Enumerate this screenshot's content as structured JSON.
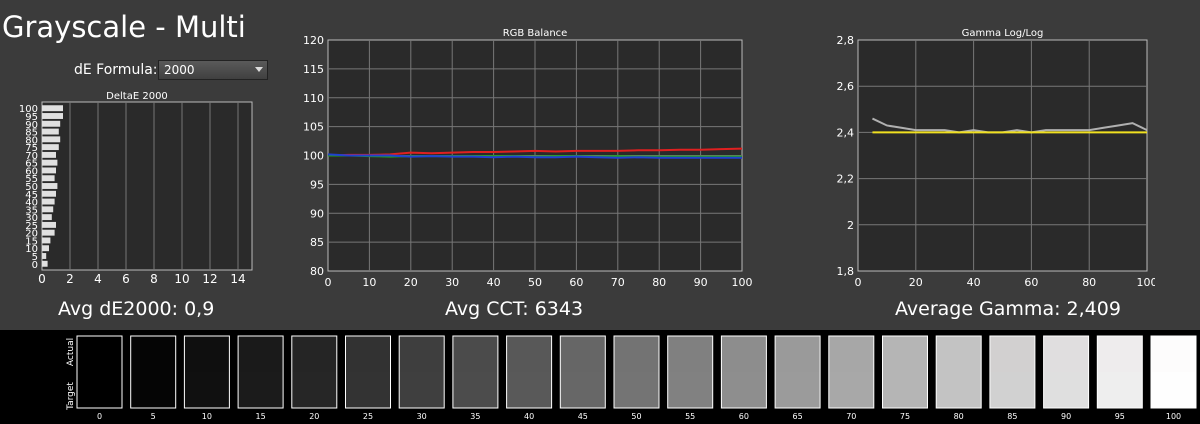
{
  "title": "Grayscale - Multi",
  "formula": {
    "label": "dE Formula:",
    "selected": "2000"
  },
  "averages": {
    "de": "Avg dE2000: 0,9",
    "cct": "Avg CCT: 6343",
    "gamma": "Average Gamma: 2,409"
  },
  "swatch_axis": {
    "actual": "Actual",
    "target": "Target"
  },
  "swatches": [
    {
      "level": "0",
      "actual": "#000000",
      "target": "#000000"
    },
    {
      "level": "5",
      "actual": "#050505",
      "target": "#050505"
    },
    {
      "level": "10",
      "actual": "#0f0f0f",
      "target": "#101010"
    },
    {
      "level": "15",
      "actual": "#1a1a1a",
      "target": "#1b1b1b"
    },
    {
      "level": "20",
      "actual": "#252525",
      "target": "#262626"
    },
    {
      "level": "25",
      "actual": "#323232",
      "target": "#333333"
    },
    {
      "level": "30",
      "actual": "#3e3e3e",
      "target": "#3f3f3f"
    },
    {
      "level": "35",
      "actual": "#4b4b4b",
      "target": "#4c4c4c"
    },
    {
      "level": "40",
      "actual": "#585858",
      "target": "#595959"
    },
    {
      "level": "45",
      "actual": "#666666",
      "target": "#676767"
    },
    {
      "level": "50",
      "actual": "#737373",
      "target": "#747474"
    },
    {
      "level": "55",
      "actual": "#808080",
      "target": "#818181"
    },
    {
      "level": "60",
      "actual": "#8d8d8d",
      "target": "#8e8e8e"
    },
    {
      "level": "65",
      "actual": "#9a9a9a",
      "target": "#9b9b9b"
    },
    {
      "level": "70",
      "actual": "#a7a7a7",
      "target": "#a8a8a8"
    },
    {
      "level": "75",
      "actual": "#b5b5b5",
      "target": "#b5b5b5"
    },
    {
      "level": "80",
      "actual": "#c3c3c3",
      "target": "#c3c3c3"
    },
    {
      "level": "85",
      "actual": "#d2d0d0",
      "target": "#d1d1d1"
    },
    {
      "level": "90",
      "actual": "#e0dedf",
      "target": "#dfdfdf"
    },
    {
      "level": "95",
      "actual": "#eeeced",
      "target": "#eeeeee"
    },
    {
      "level": "100",
      "actual": "#fdfcfc",
      "target": "#fefefe"
    }
  ],
  "chart_data": [
    {
      "type": "bar",
      "orientation": "horizontal",
      "title": "DeltaE 2000",
      "categories": [
        "0",
        "5",
        "10",
        "15",
        "20",
        "25",
        "30",
        "35",
        "40",
        "45",
        "50",
        "55",
        "60",
        "65",
        "70",
        "75",
        "80",
        "85",
        "90",
        "95",
        "100"
      ],
      "values": [
        0.4,
        0.3,
        0.5,
        0.6,
        0.9,
        1.0,
        0.7,
        0.8,
        0.9,
        1.0,
        1.1,
        0.9,
        1.0,
        1.1,
        1.0,
        1.2,
        1.3,
        1.2,
        1.3,
        1.5,
        1.5
      ],
      "xlim": [
        0,
        15
      ],
      "xticks": [
        "0",
        "2",
        "4",
        "6",
        "8",
        "10",
        "12",
        "14"
      ],
      "yticks": [
        "0",
        "5",
        "10",
        "15",
        "20",
        "25",
        "30",
        "35",
        "40",
        "45",
        "50",
        "55",
        "60",
        "65",
        "70",
        "75",
        "80",
        "85",
        "90",
        "95",
        "100"
      ],
      "colors": {
        "bar": "#e0e0e0",
        "grid": "#777777",
        "plot_bg": "#2a2a2a"
      }
    },
    {
      "type": "line",
      "title": "RGB Balance",
      "x": [
        0,
        5,
        10,
        15,
        20,
        25,
        30,
        35,
        40,
        45,
        50,
        55,
        60,
        65,
        70,
        75,
        80,
        85,
        90,
        95,
        100
      ],
      "ylim": [
        80,
        120
      ],
      "xlim": [
        0,
        100
      ],
      "xticks": [
        "0",
        "10",
        "20",
        "30",
        "40",
        "50",
        "60",
        "70",
        "80",
        "90",
        "100"
      ],
      "yticks": [
        "80",
        "85",
        "90",
        "95",
        "100",
        "105",
        "110",
        "115",
        "120"
      ],
      "series": [
        {
          "color": "#e02020",
          "values": [
            100.0,
            100.1,
            100.1,
            100.2,
            100.5,
            100.4,
            100.5,
            100.6,
            100.6,
            100.7,
            100.8,
            100.7,
            100.8,
            100.8,
            100.8,
            100.9,
            100.9,
            101.0,
            101.0,
            101.1,
            101.2
          ]
        },
        {
          "color": "#20a020",
          "values": [
            100.0,
            100.0,
            99.9,
            99.8,
            99.9,
            99.9,
            99.9,
            99.9,
            99.9,
            99.9,
            99.8,
            99.9,
            99.9,
            99.8,
            99.9,
            99.8,
            99.8,
            99.8,
            99.8,
            99.8,
            99.8
          ]
        },
        {
          "color": "#2040d0",
          "values": [
            100.2,
            100.0,
            100.0,
            100.0,
            99.8,
            99.9,
            99.8,
            99.8,
            99.7,
            99.8,
            99.7,
            99.7,
            99.8,
            99.7,
            99.6,
            99.7,
            99.6,
            99.6,
            99.6,
            99.6,
            99.6
          ]
        }
      ],
      "colors": {
        "grid": "#777777",
        "plot_bg": "#2a2a2a"
      }
    },
    {
      "type": "line",
      "title": "Gamma Log/Log",
      "x": [
        5,
        10,
        15,
        20,
        25,
        30,
        35,
        40,
        45,
        50,
        55,
        60,
        65,
        70,
        75,
        80,
        85,
        90,
        95,
        100
      ],
      "xlim": [
        0,
        100
      ],
      "ylim": [
        1.8,
        2.8
      ],
      "xticks": [
        "0",
        "20",
        "40",
        "60",
        "80",
        "100"
      ],
      "yticks": [
        "1,8",
        "2",
        "2,2",
        "2,4",
        "2,6",
        "2,8"
      ],
      "series": [
        {
          "color": "#b0b0b0",
          "values": [
            2.46,
            2.43,
            2.42,
            2.41,
            2.41,
            2.41,
            2.4,
            2.41,
            2.4,
            2.4,
            2.41,
            2.4,
            2.41,
            2.41,
            2.41,
            2.41,
            2.42,
            2.43,
            2.44,
            2.41
          ]
        },
        {
          "color": "#f0e020",
          "values": [
            2.4,
            2.4,
            2.4,
            2.4,
            2.4,
            2.4,
            2.4,
            2.4,
            2.4,
            2.4,
            2.4,
            2.4,
            2.4,
            2.4,
            2.4,
            2.4,
            2.4,
            2.4,
            2.4,
            2.4
          ]
        }
      ],
      "target_gamma": 2.4,
      "colors": {
        "grid": "#777777",
        "plot_bg": "#2a2a2a"
      }
    }
  ]
}
